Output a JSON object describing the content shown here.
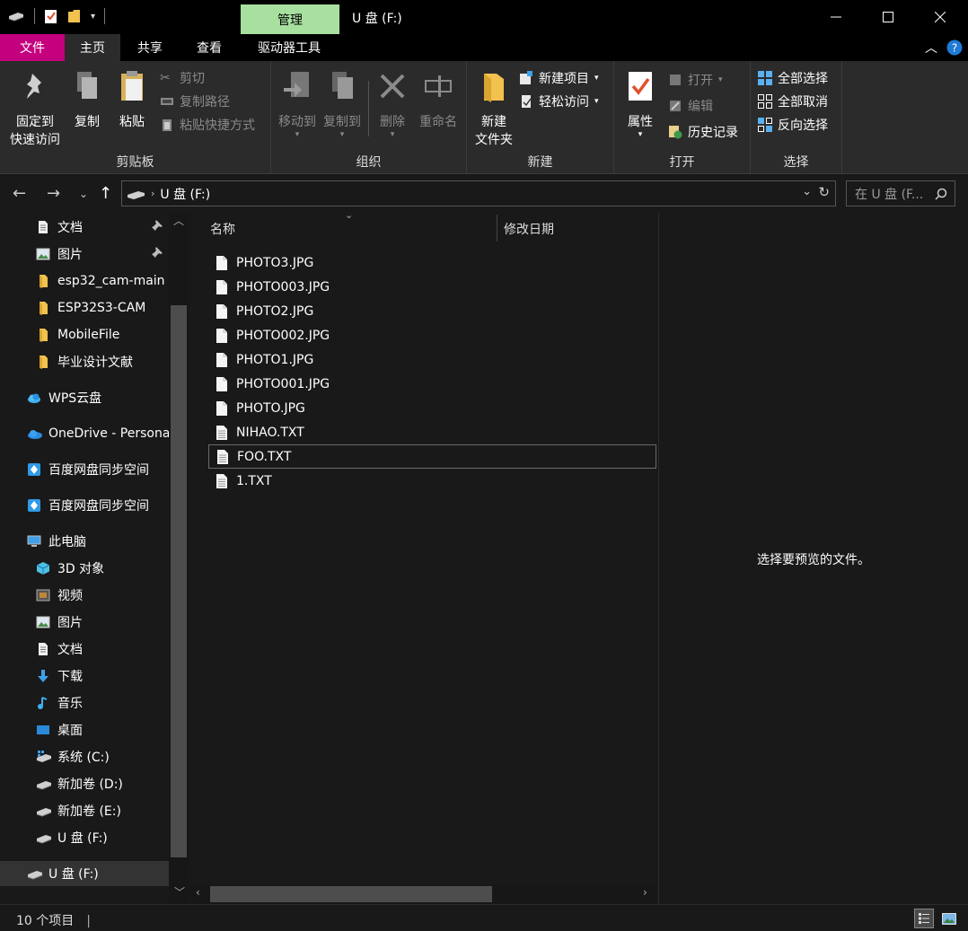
{
  "window": {
    "title": "U 盘 (F:)",
    "context_tab": "管理"
  },
  "ribbon_tabs": [
    "文件",
    "主页",
    "共享",
    "查看",
    "驱动器工具"
  ],
  "ribbon": {
    "clipboard": {
      "label": "剪贴板",
      "pin": "固定到\n快速访问",
      "copy": "复制",
      "paste": "粘贴",
      "cut": "剪切",
      "copy_path": "复制路径",
      "paste_shortcut": "粘贴快捷方式"
    },
    "organize": {
      "label": "组织",
      "move_to": "移动到",
      "copy_to": "复制到",
      "delete": "删除",
      "rename": "重命名"
    },
    "new": {
      "label": "新建",
      "new_folder": "新建\n文件夹",
      "new_item": "新建项目",
      "easy_access": "轻松访问"
    },
    "open": {
      "label": "打开",
      "properties": "属性",
      "open": "打开",
      "edit": "编辑",
      "history": "历史记录"
    },
    "select": {
      "label": "选择",
      "select_all": "全部选择",
      "select_none": "全部取消",
      "invert": "反向选择"
    }
  },
  "address": {
    "path": "U 盘 (F:)",
    "search_placeholder": "在 U 盘 (F..."
  },
  "nav_pane": [
    {
      "label": "文档",
      "icon": "document-icon",
      "pinned": true
    },
    {
      "label": "图片",
      "icon": "picture-icon",
      "pinned": true
    },
    {
      "label": "esp32_cam-main",
      "icon": "folder-icon"
    },
    {
      "label": "ESP32S3-CAM",
      "icon": "folder-icon"
    },
    {
      "label": "MobileFile",
      "icon": "folder-icon"
    },
    {
      "label": "毕业设计文献",
      "icon": "folder-icon"
    },
    {
      "label": "WPS云盘",
      "icon": "cloud-icon"
    },
    {
      "label": "OneDrive - Personal",
      "icon": "onedrive-icon"
    },
    {
      "label": "百度网盘同步空间",
      "icon": "baidu-sync-icon"
    },
    {
      "label": "百度网盘同步空间",
      "icon": "baidu-sync-icon"
    },
    {
      "label": "此电脑",
      "icon": "computer-icon"
    },
    {
      "label": "3D 对象",
      "icon": "3d-objects-icon"
    },
    {
      "label": "视频",
      "icon": "video-icon"
    },
    {
      "label": "图片",
      "icon": "picture-icon"
    },
    {
      "label": "文档",
      "icon": "document-icon"
    },
    {
      "label": "下载",
      "icon": "download-icon"
    },
    {
      "label": "音乐",
      "icon": "music-icon"
    },
    {
      "label": "桌面",
      "icon": "desktop-icon"
    },
    {
      "label": "系统 (C:)",
      "icon": "system-drive-icon"
    },
    {
      "label": "新加卷 (D:)",
      "icon": "drive-icon"
    },
    {
      "label": "新加卷 (E:)",
      "icon": "drive-icon"
    },
    {
      "label": "U 盘 (F:)",
      "icon": "usb-drive-icon"
    },
    {
      "label": "U 盘 (F:)",
      "icon": "usb-drive-icon"
    }
  ],
  "columns": {
    "name": "名称",
    "modified": "修改日期"
  },
  "files": [
    "PHOTO3.JPG",
    "PHOTO003.JPG",
    "PHOTO2.JPG",
    "PHOTO002.JPG",
    "PHOTO1.JPG",
    "PHOTO001.JPG",
    "PHOTO.JPG",
    "NIHAO.TXT",
    "FOO.TXT",
    "1.TXT"
  ],
  "preview": {
    "message": "选择要预览的文件。"
  },
  "status": {
    "count": "10 个项目"
  }
}
